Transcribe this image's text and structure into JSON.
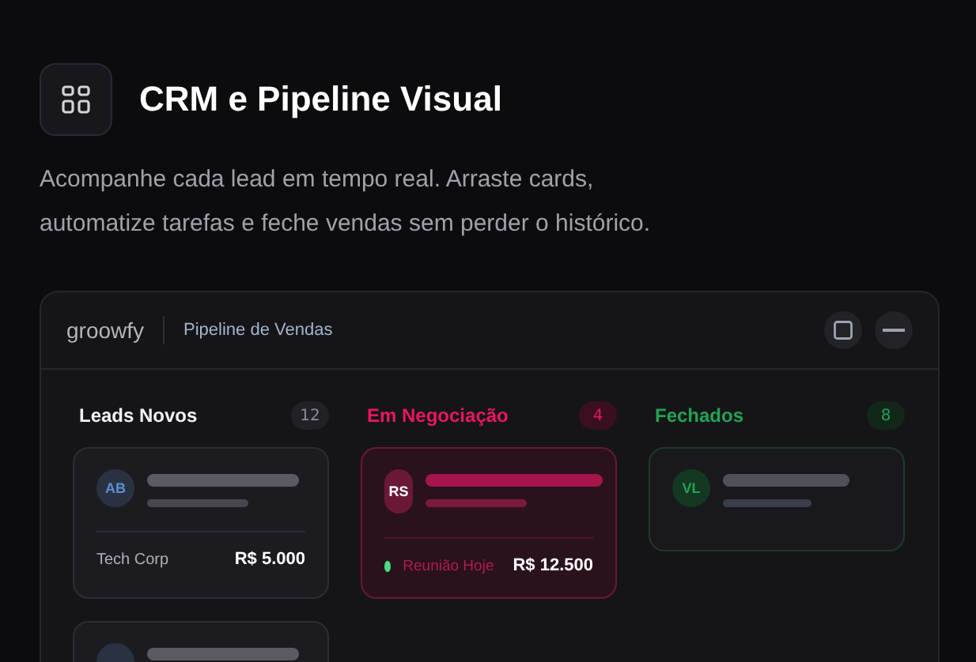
{
  "header": {
    "title": "CRM e Pipeline Visual",
    "description": "Acompanhe cada lead em tempo real. Arraste cards, automatize tarefas e feche vendas sem perder o histórico."
  },
  "window": {
    "logo": "groowfy",
    "title": "Pipeline de Vendas"
  },
  "columns": [
    {
      "title": "Leads Novos",
      "count": "12",
      "kind": "neutral",
      "color": "#f2f2f4",
      "cards": [
        {
          "initials": "AB",
          "color": "#2a3242",
          "company": "Tech Corp",
          "value": "R$ 5.000"
        },
        {
          "color": "#2a3242"
        }
      ]
    },
    {
      "title": "Em Negociação",
      "count": "4",
      "kind": "active",
      "color": "#e8185f",
      "cards": [
        {
          "initials": "RS",
          "color": "#6b1836",
          "status": {
            "label": "Reunião Hoje",
            "color": "#4ade80"
          },
          "value": "R$ 12.500"
        }
      ]
    },
    {
      "title": "Fechados",
      "count": "8",
      "kind": "won",
      "color": "#22a355",
      "cards": [
        {
          "initials": "VL",
          "color": "#143822"
        }
      ]
    }
  ]
}
